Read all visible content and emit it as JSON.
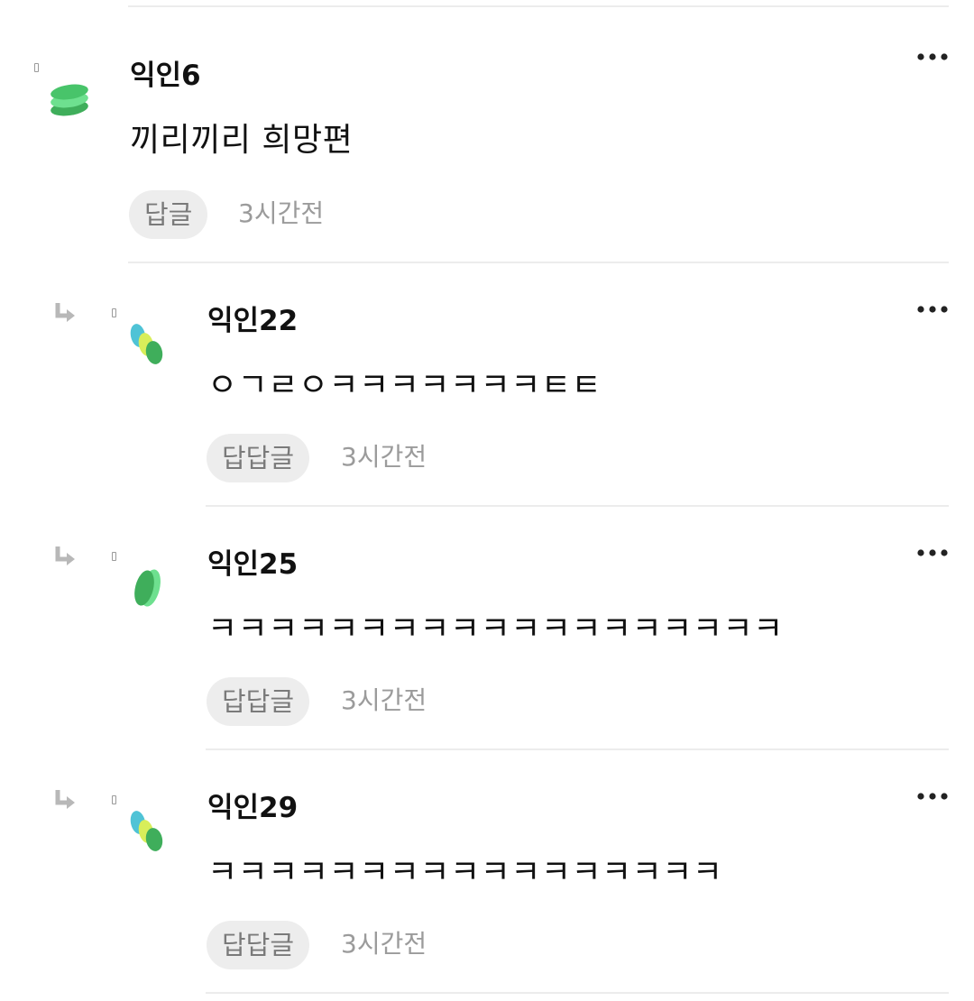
{
  "comments": [
    {
      "author": "익인6",
      "text": "끼리끼리 희망편",
      "reply_label": "답글",
      "time": "3시간전",
      "avatar_icon": "green-stack-avatar",
      "is_reply": false
    },
    {
      "author": "익인22",
      "text": "ㅇㄱㄹㅇㅋㅋㅋㅋㅋㅋㅋㅌㅌ",
      "reply_label": "답답글",
      "time": "3시간전",
      "avatar_icon": "three-ovals-avatar",
      "is_reply": true
    },
    {
      "author": "익인25",
      "text": "ㅋㅋㅋㅋㅋㅋㅋㅋㅋㅋㅋㅋㅋㅋㅋㅋㅋㅋㅋ",
      "reply_label": "답답글",
      "time": "3시간전",
      "avatar_icon": "two-ovals-avatar",
      "is_reply": true
    },
    {
      "author": "익인29",
      "text": "ㅋㅋㅋㅋㅋㅋㅋㅋㅋㅋㅋㅋㅋㅋㅋㅋㅋ",
      "reply_label": "답답글",
      "time": "3시간전",
      "avatar_icon": "three-ovals-avatar",
      "is_reply": true
    }
  ],
  "colors": {
    "divider": "#ececec",
    "button_bg": "#ededed",
    "button_text": "#7a7a7a",
    "time_text": "#9b9b9b",
    "icon_gray": "#9a9a9a",
    "avatar_green_dark": "#3fae5b",
    "avatar_green_light": "#6ee08f",
    "avatar_teal": "#4fc3d6",
    "avatar_lime": "#d8ee5a"
  }
}
